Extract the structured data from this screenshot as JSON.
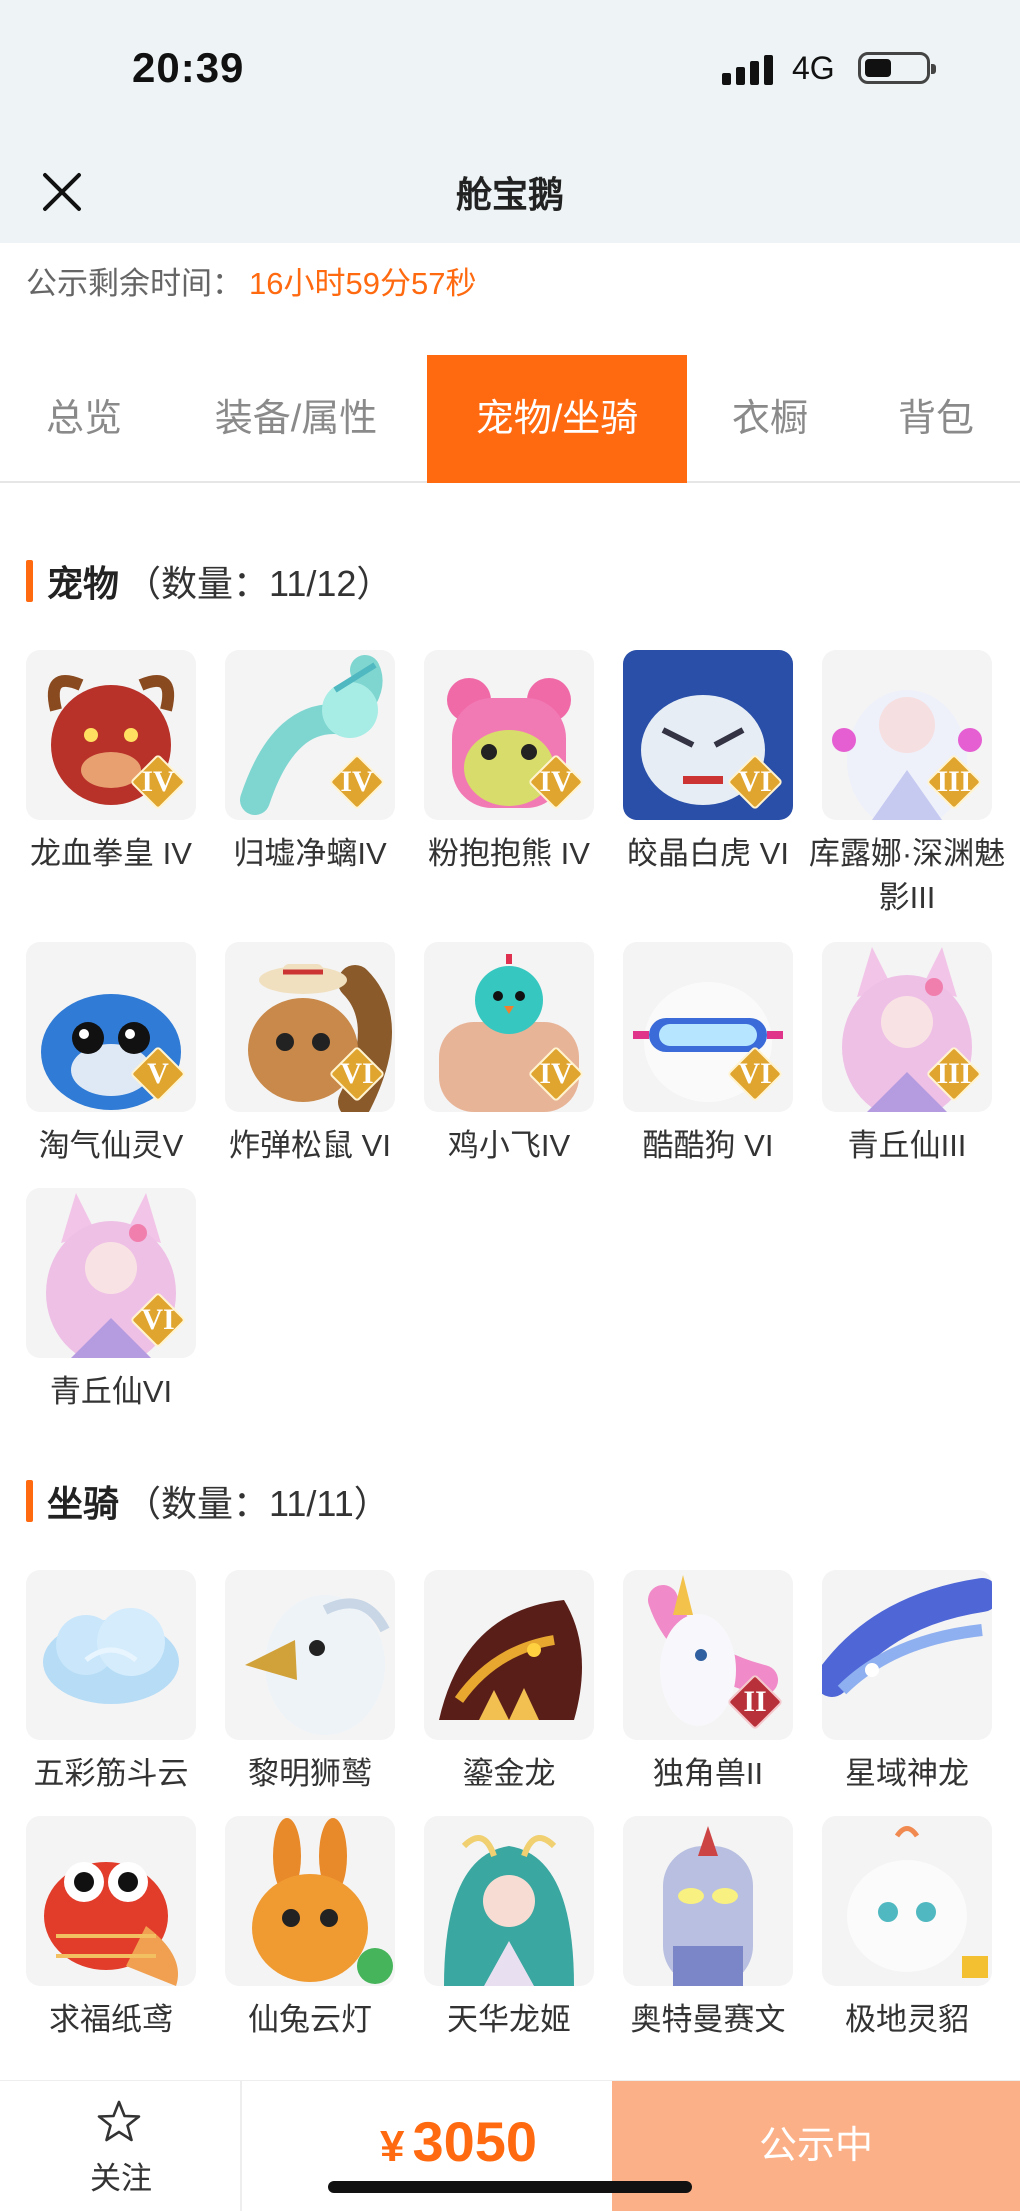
{
  "status_bar": {
    "time": "20:39",
    "network": "4G"
  },
  "nav": {
    "title": "舱宝鹅"
  },
  "timer": {
    "label": "公示剩余时间：",
    "value": "16小时59分57秒"
  },
  "tabs": [
    {
      "label": "总览",
      "active": false
    },
    {
      "label": "装备/属性",
      "active": false
    },
    {
      "label": "宠物/坐骑",
      "active": true
    },
    {
      "label": "衣橱",
      "active": false
    },
    {
      "label": "背包",
      "active": false
    }
  ],
  "pets": {
    "title": "宠物",
    "count": "（数量：11/12）",
    "items": [
      {
        "name": "龙血拳皇 IV",
        "badge": "IV",
        "icon": "red-dragon-boxer-icon"
      },
      {
        "name": "归墟净螭IV",
        "badge": "IV",
        "icon": "cyan-dragon-icon"
      },
      {
        "name": "粉抱抱熊 IV",
        "badge": "IV",
        "icon": "pink-bear-icon"
      },
      {
        "name": "皎晶白虎 VI",
        "badge": "VI",
        "icon": "white-tiger-icon"
      },
      {
        "name": "库露娜·深渊魅影III",
        "badge": "III",
        "icon": "white-hair-girl-icon"
      },
      {
        "name": "淘气仙灵V",
        "badge": "V",
        "icon": "blue-dog-icon"
      },
      {
        "name": "炸弹松鼠 VI",
        "badge": "VI",
        "icon": "squirrel-icon"
      },
      {
        "name": "鸡小飞IV",
        "badge": "IV",
        "icon": "chick-muscle-icon"
      },
      {
        "name": "酷酷狗 VI",
        "badge": "VI",
        "icon": "goggle-dog-icon"
      },
      {
        "name": "青丘仙III",
        "badge": "III",
        "icon": "fox-girl-icon"
      },
      {
        "name": "青丘仙VI",
        "badge": "VI",
        "icon": "fox-girl-icon"
      }
    ]
  },
  "mounts": {
    "title": "坐骑",
    "count": "（数量：11/11）",
    "items": [
      {
        "name": "五彩筋斗云",
        "badge": "",
        "icon": "cloud-icon"
      },
      {
        "name": "黎明狮鹫",
        "badge": "",
        "icon": "griffin-icon"
      },
      {
        "name": "鎏金龙",
        "badge": "",
        "icon": "gold-dragon-icon"
      },
      {
        "name": "独角兽II",
        "badge": "II",
        "icon": "unicorn-icon"
      },
      {
        "name": "星域神龙",
        "badge": "",
        "icon": "star-dragon-icon"
      },
      {
        "name": "求福纸鸢",
        "badge": "",
        "icon": "goldfish-kite-icon"
      },
      {
        "name": "仙兔云灯",
        "badge": "",
        "icon": "rabbit-lantern-icon"
      },
      {
        "name": "天华龙姬",
        "badge": "",
        "icon": "dragon-maiden-icon"
      },
      {
        "name": "奥特曼赛文",
        "badge": "",
        "icon": "ultraman-icon"
      },
      {
        "name": "极地灵貂",
        "badge": "",
        "icon": "polar-ferret-icon"
      }
    ]
  },
  "bottom": {
    "follow_label": "关注",
    "currency": "¥",
    "price": "3050",
    "status_label": "公示中"
  },
  "colors": {
    "accent": "#ff6a10",
    "accent_light": "#fbb087",
    "badge_gold": "#e0a52e",
    "badge_red": "#b8303a"
  }
}
